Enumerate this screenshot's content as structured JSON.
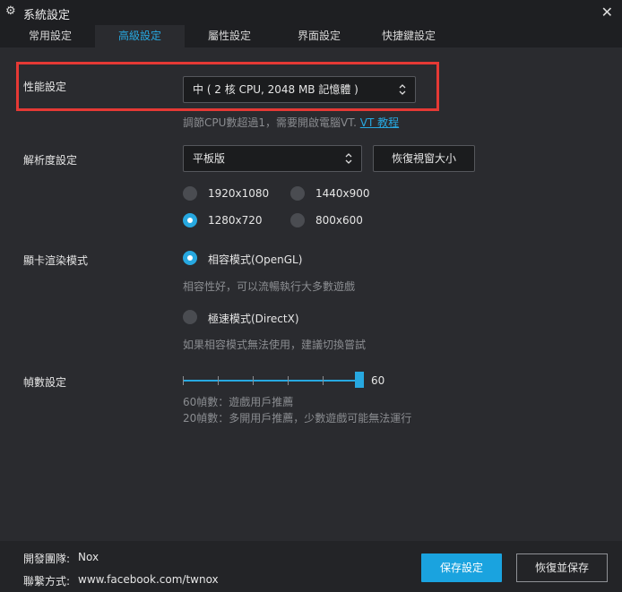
{
  "window": {
    "title": "系統設定",
    "close_glyph": "✕"
  },
  "tabs": [
    {
      "label": "常用設定"
    },
    {
      "label": "高級設定",
      "active": true
    },
    {
      "label": "屬性設定"
    },
    {
      "label": "界面設定"
    },
    {
      "label": "快捷鍵設定"
    }
  ],
  "performance": {
    "label": "性能設定",
    "selected": "中 ( 2 核 CPU, 2048 MB 記憶體 )",
    "hint_text": "調節CPU數超過1，需要開啟電腦VT. ",
    "hint_link": "VT 教程"
  },
  "resolution": {
    "label": "解析度設定",
    "selected": "平板版",
    "restore_window_button": "恢復視窗大小",
    "options": [
      {
        "label": "1920x1080",
        "selected": false
      },
      {
        "label": "1440x900",
        "selected": false
      },
      {
        "label": "1280x720",
        "selected": true
      },
      {
        "label": "800x600",
        "selected": false
      }
    ]
  },
  "graphics": {
    "label": "顯卡渲染模式",
    "modes": [
      {
        "label": "相容模式(OpenGL)",
        "selected": true,
        "description": "相容性好，可以流暢執行大多數遊戲"
      },
      {
        "label": "極速模式(DirectX)",
        "selected": false,
        "description": "如果相容模式無法使用，建議切換嘗試"
      }
    ]
  },
  "fps": {
    "label": "幀數設定",
    "value": "60",
    "note_1": "60幀數：遊戲用戶推薦",
    "note_2": "20幀數：多開用戶推薦，少數遊戲可能無法運行"
  },
  "footer": {
    "team_label": "開發團隊:",
    "team_value": "Nox",
    "contact_label": "聯繫方式:",
    "contact_value": "www.facebook.com/twnox",
    "save_button": "保存設定",
    "restore_button": "恢復並保存"
  },
  "colors": {
    "accent": "#27a8e0",
    "highlight_box": "#e53935",
    "background": "#2a2b2f"
  },
  "icons": {
    "window_icon": "gear-icon",
    "close": "close-icon",
    "select_arrows": "chevron-up-down-icon"
  }
}
